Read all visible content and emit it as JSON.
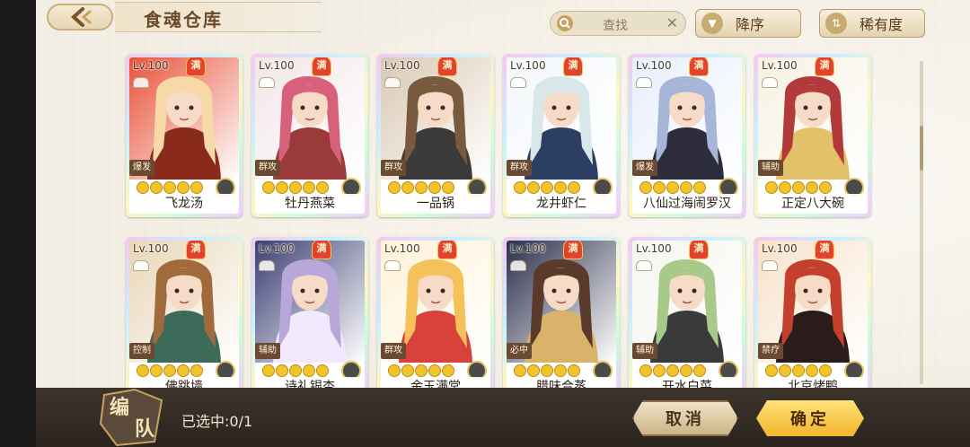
{
  "header": {
    "title": "食魂仓库",
    "search_placeholder": "查找",
    "sort_desc_label": "降序",
    "sort_rarity_label": "稀有度"
  },
  "cards": [
    {
      "level": "Lv.100",
      "max": "满",
      "role": "爆发",
      "name": "飞龙汤",
      "palette": [
        "#e8523a",
        "#f7d9a8",
        "#8a2a1c"
      ]
    },
    {
      "level": "Lv.100",
      "max": "满",
      "role": "群攻",
      "name": "牡丹燕菜",
      "palette": [
        "#f2e6e8",
        "#d7607a",
        "#9a3a3a"
      ]
    },
    {
      "level": "Lv.100",
      "max": "满",
      "role": "群攻",
      "name": "一品锅",
      "palette": [
        "#d9c8b4",
        "#7a5a3e",
        "#3d3b3a"
      ]
    },
    {
      "level": "Lv.100",
      "max": "满",
      "role": "群攻",
      "name": "龙井虾仁",
      "palette": [
        "#f3f7fb",
        "#d8e8ea",
        "#2c3e63"
      ]
    },
    {
      "level": "Lv.100",
      "max": "满",
      "role": "爆发",
      "name": "八仙过海闹罗汉",
      "palette": [
        "#e7eefc",
        "#a7b6d8",
        "#2d2c3c"
      ]
    },
    {
      "level": "Lv.100",
      "max": "满",
      "role": "辅助",
      "name": "正定八大碗",
      "palette": [
        "#f7f1e3",
        "#b23a3a",
        "#e3c16a"
      ]
    },
    {
      "level": "Lv.100",
      "max": "满",
      "role": "控制",
      "name": "佛跳墙",
      "palette": [
        "#e8d6b7",
        "#a06a3d",
        "#3d6b5a"
      ]
    },
    {
      "level": "Lv.100",
      "max": "满",
      "role": "辅助",
      "name": "诗礼银杏",
      "palette": [
        "#3a3f73",
        "#b9a7d9",
        "#f2e9ff"
      ]
    },
    {
      "level": "Lv.100",
      "max": "满",
      "role": "群攻",
      "name": "金玉满堂",
      "palette": [
        "#fff2d6",
        "#f4c15a",
        "#d9423a"
      ]
    },
    {
      "level": "Lv.100",
      "max": "满",
      "role": "必中",
      "name": "腊味合蒸",
      "palette": [
        "#2a2e4a",
        "#5a3a2a",
        "#d9b36a"
      ]
    },
    {
      "level": "Lv.100",
      "max": "满",
      "role": "辅助",
      "name": "开水白菜",
      "palette": [
        "#f4f6ef",
        "#a7c98a",
        "#3a3a3a"
      ]
    },
    {
      "level": "Lv.100",
      "max": "满",
      "role": "禁疗",
      "name": "北京烤鸭",
      "palette": [
        "#f7e1c9",
        "#c4402c",
        "#2a1c1a"
      ]
    }
  ],
  "bottom": {
    "team_char_1": "编",
    "team_char_2": "队",
    "selected_text": "已选中:0/1",
    "cancel_label": "取消",
    "confirm_label": "确定"
  }
}
